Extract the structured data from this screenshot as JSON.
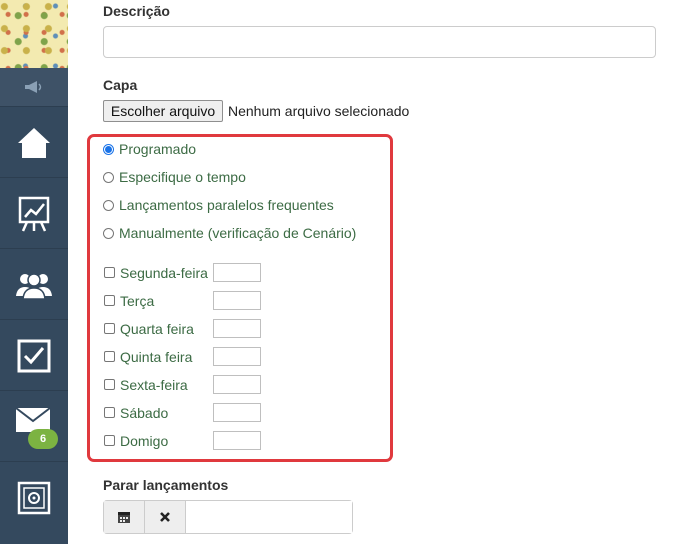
{
  "sidebar": {
    "items": [
      {
        "icon": "home-icon"
      },
      {
        "icon": "presentation-chart-icon"
      },
      {
        "icon": "users-icon"
      },
      {
        "icon": "checkbox-icon"
      },
      {
        "icon": "mail-icon",
        "badge": "6"
      },
      {
        "icon": "safe-icon"
      }
    ]
  },
  "form": {
    "description_label": "Descrição",
    "cover_label": "Capa",
    "file_button": "Escolher arquivo",
    "file_status": "Nenhum arquivo selecionado",
    "schedule_options": [
      {
        "label": "Programado",
        "selected": true
      },
      {
        "label": "Especifique o tempo",
        "selected": false
      },
      {
        "label": "Lançamentos paralelos frequentes",
        "selected": false
      },
      {
        "label": "Manualmente (verificação de Cenário)",
        "selected": false
      }
    ],
    "days": [
      {
        "label": "Segunda-feira",
        "checked": false,
        "value": ""
      },
      {
        "label": "Terça",
        "checked": false,
        "value": ""
      },
      {
        "label": "Quarta feira",
        "checked": false,
        "value": ""
      },
      {
        "label": "Quinta feira",
        "checked": false,
        "value": ""
      },
      {
        "label": "Sexta-feira",
        "checked": false,
        "value": ""
      },
      {
        "label": "Sábado",
        "checked": false,
        "value": ""
      },
      {
        "label": "Domigo",
        "checked": false,
        "value": ""
      }
    ],
    "stop_label": "Parar lançamentos"
  },
  "colors": {
    "sidebar": "#34495e",
    "highlight": "#e0393e",
    "option_text": "#3c6b44",
    "badge": "#7cb342"
  }
}
